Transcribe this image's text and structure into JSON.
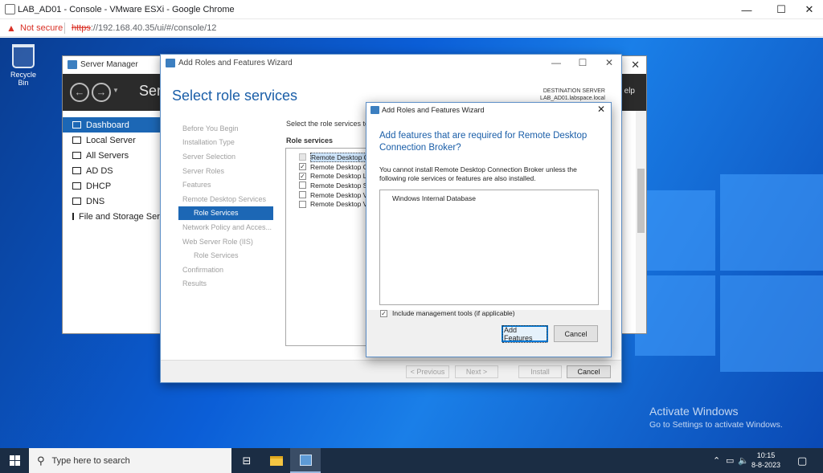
{
  "browser": {
    "tab_title": "LAB_AD01 - Console - VMware ESXi - Google Chrome",
    "security_label": "Not secure",
    "url_scheme": "https",
    "url_rest": "://192.168.40.35/ui/#/console/12",
    "minimize": "—",
    "maximize": "☐",
    "close": "✕"
  },
  "desktop": {
    "recycle_bin": "Recycle Bin",
    "activate_title": "Activate Windows",
    "activate_sub": "Go to Settings to activate Windows."
  },
  "server_manager": {
    "title": "Server Manager",
    "header_title": "Serv",
    "help": "elp",
    "nav": [
      {
        "label": "Dashboard"
      },
      {
        "label": "Local Server"
      },
      {
        "label": "All Servers"
      },
      {
        "label": "AD DS"
      },
      {
        "label": "DHCP"
      },
      {
        "label": "DNS"
      },
      {
        "label": "File and Storage Serv"
      }
    ]
  },
  "wizard": {
    "title": "Add Roles and Features Wizard",
    "heading": "Select role services",
    "destination_label": "DESTINATION SERVER",
    "destination_server": "LAB_AD01.labspace.local",
    "steps": [
      {
        "label": "Before You Begin"
      },
      {
        "label": "Installation Type"
      },
      {
        "label": "Server Selection"
      },
      {
        "label": "Server Roles"
      },
      {
        "label": "Features"
      },
      {
        "label": "Remote Desktop Services"
      },
      {
        "label": "Role Services"
      },
      {
        "label": "Network Policy and Acces..."
      },
      {
        "label": "Web Server Role (IIS)"
      },
      {
        "label": "Role Services"
      },
      {
        "label": "Confirmation"
      },
      {
        "label": "Results"
      }
    ],
    "description": "Select the role services to",
    "column_header": "Role services",
    "role_services": [
      {
        "label": "Remote Desktop C",
        "checked": ""
      },
      {
        "label": "Remote Desktop G",
        "checked": "✓"
      },
      {
        "label": "Remote Desktop L",
        "checked": "✓"
      },
      {
        "label": "Remote Desktop S",
        "checked": ""
      },
      {
        "label": "Remote Desktop V",
        "checked": ""
      },
      {
        "label": "Remote Desktop V",
        "checked": ""
      }
    ],
    "btn_previous": "< Previous",
    "btn_next": "Next >",
    "btn_install": "Install",
    "btn_cancel": "Cancel"
  },
  "dialog": {
    "title": "Add Roles and Features Wizard",
    "heading": "Add features that are required for Remote Desktop Connection Broker?",
    "text": "You cannot install Remote Desktop Connection Broker unless the following role services or features are also installed.",
    "required_feature": "Windows Internal Database",
    "include_tools_label": "Include management tools (if applicable)",
    "include_tools_check": "✓",
    "btn_add": "Add Features",
    "btn_cancel": "Cancel",
    "close": "✕"
  },
  "taskbar": {
    "search_placeholder": "Type here to search",
    "time": "10:15",
    "date": "8-8-2023"
  },
  "colors": {
    "accent": "#1c67b5",
    "heading_blue": "#1a5ea8",
    "warning_red": "#d93025"
  }
}
